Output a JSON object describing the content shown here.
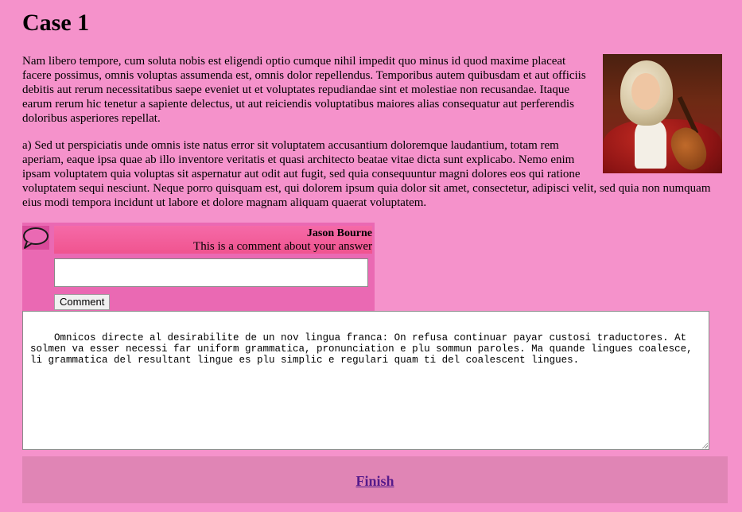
{
  "page": {
    "title": "Case 1"
  },
  "article": {
    "paragraph_1": "Nam libero tempore, cum soluta nobis est eligendi optio cumque nihil impedit quo minus id quod maxime placeat facere possimus, omnis voluptas assumenda est, omnis dolor repellendus. Temporibus autem quibusdam et aut officiis debitis aut rerum necessitatibus saepe eveniet ut et voluptates repudiandae sint et molestiae non recusandae. Itaque earum rerum hic tenetur a sapiente delectus, ut aut reiciendis voluptatibus maiores alias consequatur aut perferendis doloribus asperiores repellat.",
    "paragraph_2": "a) Sed ut perspiciatis unde omnis iste natus error sit voluptatem accusantium doloremque laudantium, totam rem aperiam, eaque ipsa quae ab illo inventore veritatis et quasi architecto beatae vitae dicta sunt explicabo. Nemo enim ipsam voluptatem quia voluptas sit aspernatur aut odit aut fugit, sed quia consequuntur magni dolores eos qui ratione voluptatem sequi nesciunt. Neque porro quisquam est, qui dolorem ipsum quia dolor sit amet, consectetur, adipisci velit, sed quia non numquam eius modi tempora incidunt ut labore et dolore magnam aliquam quaerat voluptatem."
  },
  "comment": {
    "author": "Jason Bourne",
    "text": "This is a comment about your answer",
    "input_value": "",
    "button_label": "Comment"
  },
  "answer": {
    "value": "Omnicos directe al desirabilite de un nov lingua franca: On refusa continuar payar custosi traductores. At solmen va esser necessi far uniform grammatica, pronunciation e plu sommun paroles. Ma quande lingues coalesce, li grammatica del resultant lingue es plu simplic e regulari quam ti del coalescent lingues."
  },
  "footer": {
    "finish_label": "Finish"
  },
  "colors": {
    "background": "#f592cb",
    "comment_panel": "#ea69b3",
    "comment_header": "#f0548f",
    "finish_bar": "#e085b5",
    "link": "#551a8b"
  },
  "icons": {
    "comment": "speech-bubble-icon"
  }
}
